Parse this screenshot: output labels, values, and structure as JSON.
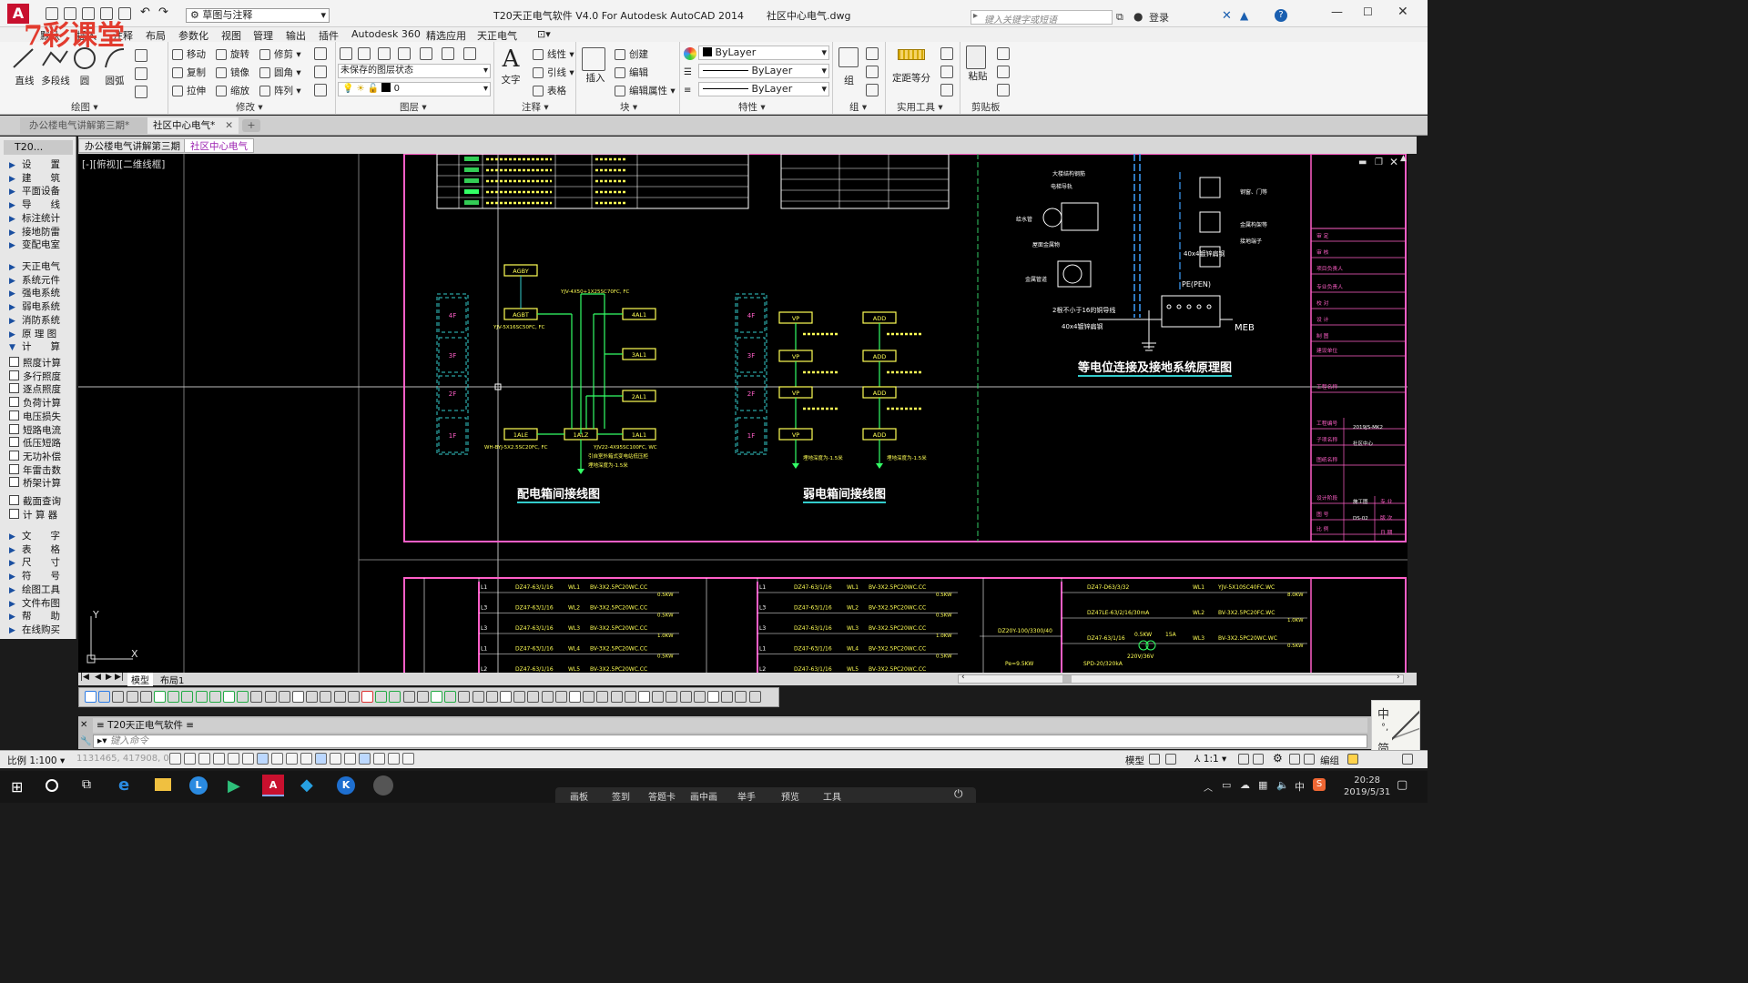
{
  "watermark": "7彩课堂",
  "app": {
    "title": "T20天正电气软件 V4.0 For Autodesk AutoCAD 2014",
    "filename": "社区中心电气.dwg",
    "workspace": "草图与注释",
    "search_placeholder": "键入关键字或短语",
    "login": "登录"
  },
  "menu": [
    "默认",
    "插入",
    "注释",
    "布局",
    "参数化",
    "视图",
    "管理",
    "输出",
    "插件",
    "Autodesk 360",
    "精选应用",
    "天正电气"
  ],
  "ribbon": {
    "draw": {
      "line": "直线",
      "polyline": "多段线",
      "circle": "圆",
      "arc": "圆弧",
      "label": "绘图"
    },
    "modify": {
      "move": "移动",
      "rotate": "旋转",
      "trim": "修剪",
      "copy": "复制",
      "mirror": "镜像",
      "fillet": "圆角",
      "stretch": "拉伸",
      "scale": "缩放",
      "array": "阵列",
      "label": "修改"
    },
    "layer": {
      "state": "未保存的图层状态",
      "current": "0",
      "label": "图层"
    },
    "annotation": {
      "text": "文字",
      "linear": "线性",
      "leader": "引线",
      "table": "表格",
      "label": "注释"
    },
    "block": {
      "insert": "插入",
      "create": "创建",
      "edit": "编辑",
      "edit_attr": "编辑属性",
      "label": "块"
    },
    "properties": {
      "color": "ByLayer",
      "linetype": "ByLayer",
      "lineweight": "ByLayer",
      "label": "特性"
    },
    "group": {
      "group": "组",
      "label": "组"
    },
    "utilities": {
      "measure": "定距等分",
      "label": "实用工具"
    },
    "clipboard": {
      "paste": "粘贴",
      "label": "剪贴板"
    }
  },
  "doc_tabs": [
    "办公楼电气讲解第三期*",
    "社区中心电气*"
  ],
  "drawing_tabs": [
    "办公楼电气讲解第三期",
    "社区中心电气"
  ],
  "left_panel": {
    "header": "T20...",
    "group1": [
      "设　　置",
      "建　　筑",
      "平面设备",
      "导　　线",
      "标注统计",
      "接地防雷",
      "变配电室"
    ],
    "group2": [
      "天正电气",
      "系统元件",
      "强电系统",
      "弱电系统",
      "消防系统",
      "原 理 图",
      "计　　算"
    ],
    "group3": [
      "照度计算",
      "多行照度",
      "逐点照度",
      "负荷计算",
      "电压损失",
      "短路电流",
      "低压短路",
      "无功补偿",
      "年雷击数",
      "桥架计算"
    ],
    "group4": [
      "截面查询",
      "计 算 器"
    ],
    "group5": [
      "文　　字",
      "表　　格",
      "尺　　寸",
      "符　　号",
      "绘图工具",
      "文件布图",
      "帮　　助",
      "在线购买"
    ]
  },
  "viewport": {
    "label": "[-][俯视][二维线框]"
  },
  "drawing": {
    "title_power": "配电箱间接线图",
    "title_weak": "弱电箱间接线图",
    "title_ground": "等电位连接及接地系统原理图",
    "floors": [
      "4F",
      "3F",
      "2F",
      "1F"
    ],
    "boxes_power": [
      "AGBY",
      "AGBT",
      "4AL1",
      "3AL1",
      "2AL1",
      "1AL1",
      "1ALE",
      "1ALZ"
    ],
    "boxes_weak_vp": [
      "VP",
      "VP",
      "VP",
      "VP"
    ],
    "boxes_weak_add": [
      "ADD",
      "ADD",
      "ADD",
      "ADD"
    ],
    "cable_top": "YJV-4X50+1X25SC70FC, FC",
    "cable_agbt": "YJV-5X16SC50FC, FC",
    "cable_1ale": "WH-BYJ-5X2.5SC20FC, FC",
    "cable_1alz": "YJV22-4X95SC100FC, WC",
    "note_1alz_1": "引自室外箱式变电站低压柜",
    "note_1alz_2": "埋地深度为-1.5米",
    "note_weak_1": "埋地深度为-1.5米",
    "note_weak_2": "埋地深度为-1.5米",
    "mebl": "MEB",
    "pe": "PE(PEN)",
    "ground_note1": "2根不小于16的铜导线",
    "ground_note2": "40x4镀锌扁钢",
    "ground_note3": "40x4镀锌扁钢",
    "ground_labels": [
      "大楼结构钢筋",
      "电梯导轨",
      "给水管",
      "屋面金属物",
      "金属管道",
      "钢窗、门等",
      "金属构架等",
      "接地端子"
    ],
    "title_block": [
      "审 定",
      "审 核",
      "项目负责人",
      "专业负责人",
      "校 对",
      "设 计",
      "制 图",
      "建设单位",
      "工程名称",
      "工程编号",
      "子项名称",
      "图纸名称",
      "设计阶段",
      "图 号",
      "比 例",
      "专 业",
      "版 次",
      "日 期"
    ],
    "tb_values": {
      "project_no": "2019JS-MK2",
      "subitem": "社区中心",
      "stage": "施工图",
      "drawing_no": "DS-02"
    },
    "panel_rows": [
      {
        "phase": "L1",
        "breaker": "DZ47-63/1/16",
        "id": "WL1",
        "cable": "BV-3X2.5PC20WC.CC",
        "load": "0.5KW"
      },
      {
        "phase": "L3",
        "breaker": "DZ47-63/1/16",
        "id": "WL2",
        "cable": "BV-3X2.5PC20WC.CC",
        "load": "0.5KW"
      },
      {
        "phase": "L3",
        "breaker": "DZ47-63/1/16",
        "id": "WL3",
        "cable": "BV-3X2.5PC20WC.CC",
        "load": "1.0KW"
      },
      {
        "phase": "L1",
        "breaker": "DZ47-63/1/16",
        "id": "WL4",
        "cable": "BV-3X2.5PC20WC.CC",
        "load": "0.5KW"
      },
      {
        "phase": "L2",
        "breaker": "DZ47-63/1/16",
        "id": "WL5",
        "cable": "BV-3X2.5PC20WC.CC",
        "load": "1.0KW"
      }
    ],
    "panel3": {
      "main": "DZ20Y-100/3300/40",
      "pe": "Pe=9.5KW",
      "r1": "DZ47-D63/3/32",
      "r2": "DZ47LE-63/2/16/30mA",
      "r3": "DZ47-63/1/16",
      "c1": "YJV-5X10SC40FC.WC",
      "c2": "BV-3X2.5PC20FC.WC",
      "c3": "BV-3X2.5PC20WC.WC",
      "tr": "220V/36V",
      "tr_kw": "0.5KW",
      "fuse": "15A",
      "spd": "SPD-20/320kA",
      "l1": "WL1",
      "l2": "WL2",
      "l3": "WL3",
      "k1": "8.0KW",
      "k2": "1.0KW",
      "k3": "0.5KW"
    }
  },
  "layout_tabs": [
    "模型",
    "布局1"
  ],
  "t20_title": "T20天正电气软件",
  "cmd_placeholder": "键入命令",
  "status": {
    "scale": "比例 1:100",
    "coords": "1131465, 417908, 0",
    "model": "模型",
    "anno": "1:1"
  },
  "taskbar": {
    "time": "20:28",
    "date": "2019/5/31",
    "items": [
      "画板",
      "签到",
      "答题卡",
      "画中画",
      "举手",
      "预览",
      "工具"
    ],
    "ime": "中"
  },
  "colors": {
    "pink": "#ff5fc8",
    "green": "#33ff66",
    "yellow": "#ffff55",
    "cyan": "#33cccc",
    "white": "#ffffff"
  }
}
